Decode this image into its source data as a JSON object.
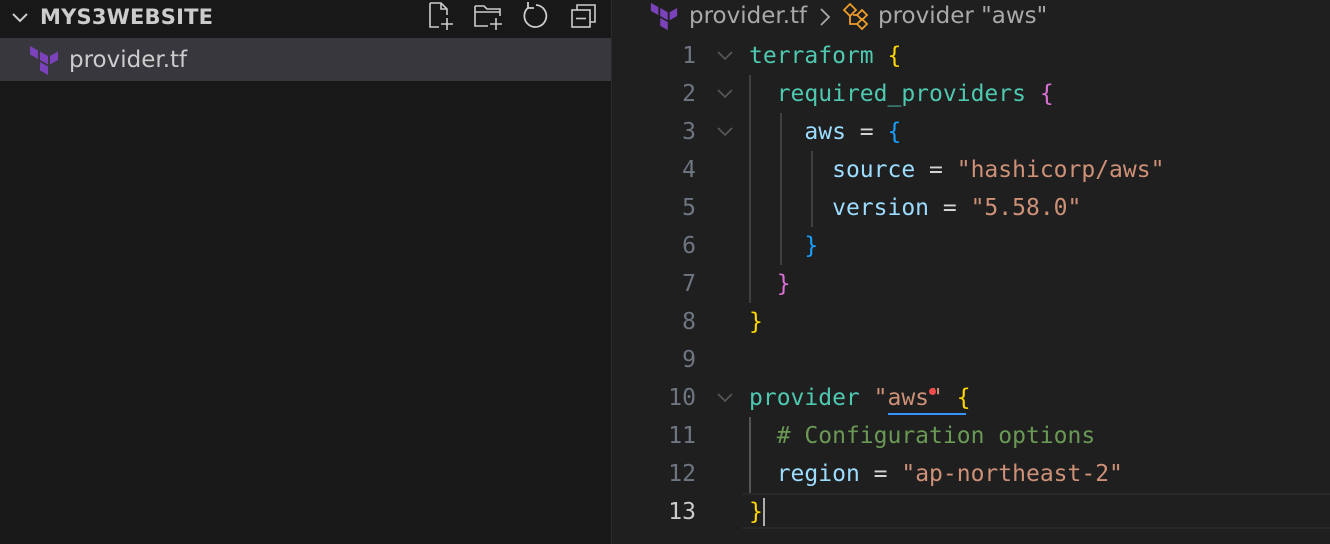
{
  "explorer": {
    "title": "MYS3WEBSITE",
    "actions": [
      "new-file-icon",
      "new-folder-icon",
      "refresh-icon",
      "collapse-all-icon"
    ],
    "files": [
      {
        "name": "provider.tf",
        "icon": "terraform-icon",
        "selected": true
      }
    ]
  },
  "breadcrumb": {
    "file": "provider.tf",
    "symbol": "provider \"aws\""
  },
  "editor": {
    "active_line": 13,
    "colors": {
      "keyword": "#4ec9b0",
      "property": "#9cdcfe",
      "string": "#ce9178",
      "comment": "#6a9955",
      "bracket_level1": "#ffd700",
      "bracket_level2": "#da70d6",
      "bracket_level3": "#179fff"
    },
    "lines": [
      {
        "num": "1",
        "tokens": [
          "terraform",
          " ",
          "{"
        ]
      },
      {
        "num": "2",
        "tokens": [
          "  ",
          "required_providers",
          " ",
          "{"
        ]
      },
      {
        "num": "3",
        "tokens": [
          "    ",
          "aws",
          " = ",
          "{"
        ]
      },
      {
        "num": "4",
        "tokens": [
          "      ",
          "source",
          " = ",
          "\"hashicorp/aws\""
        ]
      },
      {
        "num": "5",
        "tokens": [
          "      ",
          "version",
          " = ",
          "\"5.58.0\""
        ]
      },
      {
        "num": "6",
        "tokens": [
          "    ",
          "}"
        ]
      },
      {
        "num": "7",
        "tokens": [
          "  ",
          "}"
        ]
      },
      {
        "num": "8",
        "tokens": [
          "}"
        ]
      },
      {
        "num": "9",
        "tokens": [
          ""
        ]
      },
      {
        "num": "10",
        "tokens": [
          "provider",
          " ",
          "\"aws\"",
          " ",
          "{"
        ]
      },
      {
        "num": "11",
        "tokens": [
          "  ",
          "# Configuration options"
        ]
      },
      {
        "num": "12",
        "tokens": [
          "  ",
          "region",
          " = ",
          "\"ap-northeast-2\""
        ]
      },
      {
        "num": "13",
        "tokens": [
          "}"
        ]
      }
    ]
  }
}
